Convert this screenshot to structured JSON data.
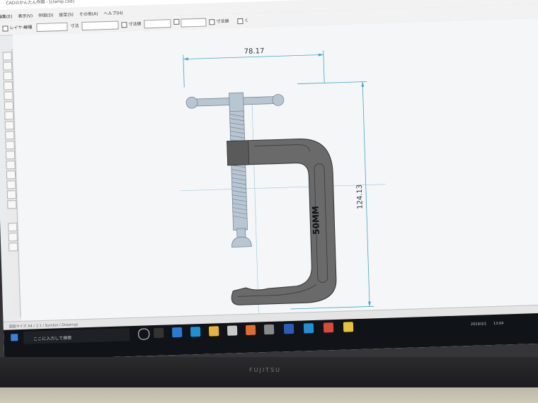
{
  "window": {
    "title": "CADのかんたん作図 - [clamp.cad]"
  },
  "menu": {
    "items": [
      "編集(E)",
      "表示(V)",
      "作図(D)",
      "設定(S)",
      "その他(A)",
      "ヘルプ(H)"
    ]
  },
  "toolbar": {
    "layer_label": "レイヤー",
    "linetype_label": "線種",
    "dimension_label": "寸法",
    "snap_label": "寸法値",
    "auto_label": "寸法値",
    "extra_label": "く"
  },
  "drawing": {
    "width_dim": "78.17",
    "height_dim": "124.13",
    "engraving": "50MM",
    "clamp_color": "#6a6a6a",
    "handle_color": "#b8c6d2",
    "dim_color": "#3fa8c8"
  },
  "status": {
    "text": "図面サイズ  A4 / 1:1  /  Symbol  /  Drawings"
  },
  "taskbar": {
    "search_placeholder": "ここに入力して検索",
    "clock": "13:04",
    "date": "2019/3/1"
  },
  "laptop": {
    "brand": "FUJITSU"
  }
}
